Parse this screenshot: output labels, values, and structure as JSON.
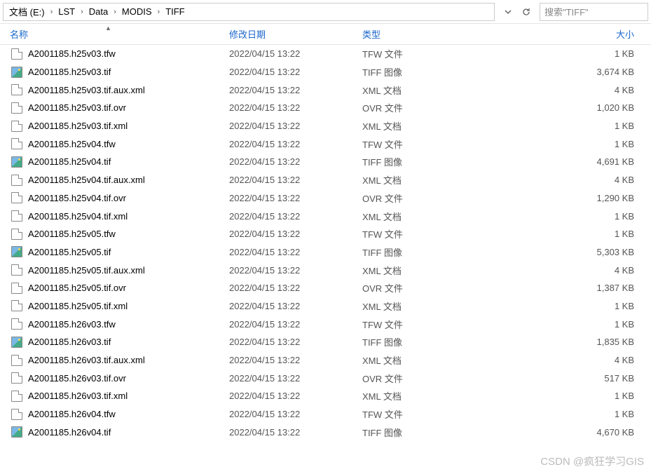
{
  "breadcrumb": [
    {
      "label": "文档 (E:)"
    },
    {
      "label": "LST"
    },
    {
      "label": "Data"
    },
    {
      "label": "MODIS"
    },
    {
      "label": "TIFF"
    }
  ],
  "search": {
    "placeholder": "搜索\"TIFF\""
  },
  "columns": {
    "name": "名称",
    "date": "修改日期",
    "type": "类型",
    "size": "大小"
  },
  "files": [
    {
      "icon": "file",
      "name": "A2001185.h25v03.tfw",
      "date": "2022/04/15 13:22",
      "type": "TFW 文件",
      "size": "1 KB"
    },
    {
      "icon": "img",
      "name": "A2001185.h25v03.tif",
      "date": "2022/04/15 13:22",
      "type": "TIFF 图像",
      "size": "3,674 KB"
    },
    {
      "icon": "file",
      "name": "A2001185.h25v03.tif.aux.xml",
      "date": "2022/04/15 13:22",
      "type": "XML 文档",
      "size": "4 KB"
    },
    {
      "icon": "file",
      "name": "A2001185.h25v03.tif.ovr",
      "date": "2022/04/15 13:22",
      "type": "OVR 文件",
      "size": "1,020 KB"
    },
    {
      "icon": "file",
      "name": "A2001185.h25v03.tif.xml",
      "date": "2022/04/15 13:22",
      "type": "XML 文档",
      "size": "1 KB"
    },
    {
      "icon": "file",
      "name": "A2001185.h25v04.tfw",
      "date": "2022/04/15 13:22",
      "type": "TFW 文件",
      "size": "1 KB"
    },
    {
      "icon": "img",
      "name": "A2001185.h25v04.tif",
      "date": "2022/04/15 13:22",
      "type": "TIFF 图像",
      "size": "4,691 KB"
    },
    {
      "icon": "file",
      "name": "A2001185.h25v04.tif.aux.xml",
      "date": "2022/04/15 13:22",
      "type": "XML 文档",
      "size": "4 KB"
    },
    {
      "icon": "file",
      "name": "A2001185.h25v04.tif.ovr",
      "date": "2022/04/15 13:22",
      "type": "OVR 文件",
      "size": "1,290 KB"
    },
    {
      "icon": "file",
      "name": "A2001185.h25v04.tif.xml",
      "date": "2022/04/15 13:22",
      "type": "XML 文档",
      "size": "1 KB"
    },
    {
      "icon": "file",
      "name": "A2001185.h25v05.tfw",
      "date": "2022/04/15 13:22",
      "type": "TFW 文件",
      "size": "1 KB"
    },
    {
      "icon": "img",
      "name": "A2001185.h25v05.tif",
      "date": "2022/04/15 13:22",
      "type": "TIFF 图像",
      "size": "5,303 KB"
    },
    {
      "icon": "file",
      "name": "A2001185.h25v05.tif.aux.xml",
      "date": "2022/04/15 13:22",
      "type": "XML 文档",
      "size": "4 KB"
    },
    {
      "icon": "file",
      "name": "A2001185.h25v05.tif.ovr",
      "date": "2022/04/15 13:22",
      "type": "OVR 文件",
      "size": "1,387 KB"
    },
    {
      "icon": "file",
      "name": "A2001185.h25v05.tif.xml",
      "date": "2022/04/15 13:22",
      "type": "XML 文档",
      "size": "1 KB"
    },
    {
      "icon": "file",
      "name": "A2001185.h26v03.tfw",
      "date": "2022/04/15 13:22",
      "type": "TFW 文件",
      "size": "1 KB"
    },
    {
      "icon": "img",
      "name": "A2001185.h26v03.tif",
      "date": "2022/04/15 13:22",
      "type": "TIFF 图像",
      "size": "1,835 KB"
    },
    {
      "icon": "file",
      "name": "A2001185.h26v03.tif.aux.xml",
      "date": "2022/04/15 13:22",
      "type": "XML 文档",
      "size": "4 KB"
    },
    {
      "icon": "file",
      "name": "A2001185.h26v03.tif.ovr",
      "date": "2022/04/15 13:22",
      "type": "OVR 文件",
      "size": "517 KB"
    },
    {
      "icon": "file",
      "name": "A2001185.h26v03.tif.xml",
      "date": "2022/04/15 13:22",
      "type": "XML 文档",
      "size": "1 KB"
    },
    {
      "icon": "file",
      "name": "A2001185.h26v04.tfw",
      "date": "2022/04/15 13:22",
      "type": "TFW 文件",
      "size": "1 KB"
    },
    {
      "icon": "img",
      "name": "A2001185.h26v04.tif",
      "date": "2022/04/15 13:22",
      "type": "TIFF 图像",
      "size": "4,670 KB"
    }
  ],
  "watermark": "CSDN @疯狂学习GIS"
}
